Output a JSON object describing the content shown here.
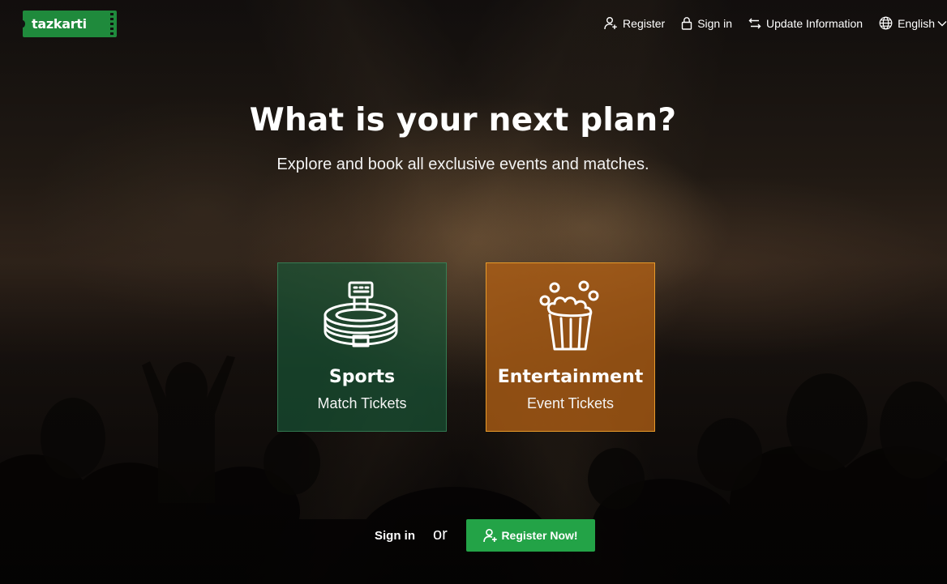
{
  "logo": {
    "text": "tazkarti"
  },
  "nav": {
    "register": "Register",
    "sign_in": "Sign in",
    "update_information": "Update Information",
    "language": "English"
  },
  "hero": {
    "title": "What is your next plan?",
    "subtitle": "Explore and book all exclusive events and matches."
  },
  "cards": {
    "sports": {
      "title": "Sports",
      "subtitle": "Match Tickets",
      "icon": "stadium-icon"
    },
    "entertainment": {
      "title": "Entertainment",
      "subtitle": "Event Tickets",
      "icon": "popcorn-icon"
    }
  },
  "bottom": {
    "sign_in": "Sign in",
    "or": "or",
    "register_now": "Register Now!"
  },
  "colors": {
    "brand_green": "#1f8a3c",
    "register_green": "#23a347",
    "entertainment_orange": "#e79a2a"
  }
}
